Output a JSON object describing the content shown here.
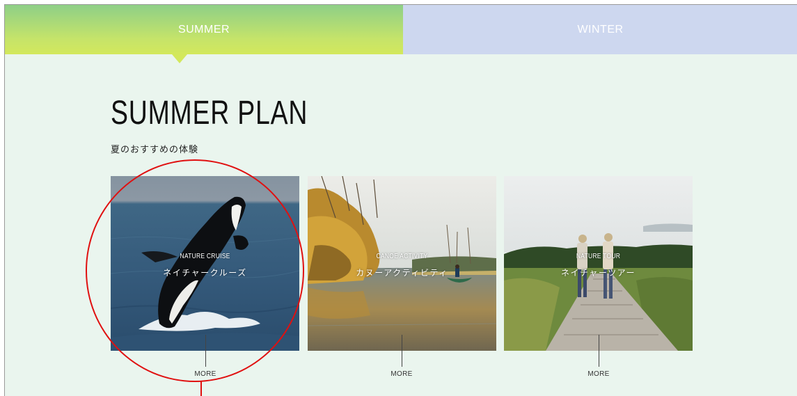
{
  "tabs": {
    "summer_label": "SUMMER",
    "winter_label": "WINTER",
    "active": "summer"
  },
  "section": {
    "title": "SUMMER PLAN",
    "subtitle": "夏のおすすめの体験"
  },
  "cards": [
    {
      "en": "NATURE CRUISE",
      "jp": "ネイチャークルーズ",
      "more": "MORE",
      "photo": "orca-breaching"
    },
    {
      "en": "CANOE ACTIVITY",
      "jp": "カヌーアクティビティ",
      "more": "MORE",
      "photo": "canoe-river"
    },
    {
      "en": "NATURE TOUR",
      "jp": "ネイチャーツアー",
      "more": "MORE",
      "photo": "boardwalk-hikers"
    }
  ],
  "colors": {
    "background": "#eaf5ee",
    "summer_tab_top": "#8ecf87",
    "summer_tab_bottom": "#d3e85c",
    "winter_tab": "#cdd7ef",
    "annotation": "#e01010"
  },
  "annotation": {
    "shape": "circle",
    "target": "cards.0"
  }
}
